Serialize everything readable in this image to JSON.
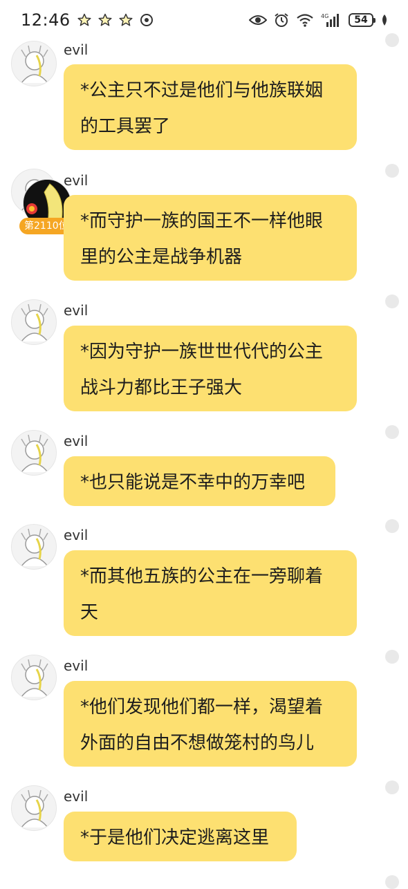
{
  "status_bar": {
    "time": "12:46",
    "network_label": "4G",
    "battery_level": "54"
  },
  "messages": [
    {
      "user": "evil",
      "text": "*公主只不过是他们与他族联姻的工具罢了"
    },
    {
      "user": "evil",
      "text": "*而守护一族的国王不一样他眼里的公主是战争机器",
      "rank_badge": "第2110位"
    },
    {
      "user": "evil",
      "text": "*因为守护一族世世代代的公主战斗力都比王子强大"
    },
    {
      "user": "evil",
      "text": "*也只能说是不幸中的万幸吧"
    },
    {
      "user": "evil",
      "text": "*而其他五族的公主在一旁聊着天"
    },
    {
      "user": "evil",
      "text": "*他们发现他们都一样，渴望着外面的自由不想做笼村的鸟儿"
    },
    {
      "user": "evil",
      "text": "*于是他们决定逃离这里"
    }
  ],
  "colors": {
    "bubble": "#fde071",
    "badge": "#f5a623",
    "background": "#ffffff"
  }
}
